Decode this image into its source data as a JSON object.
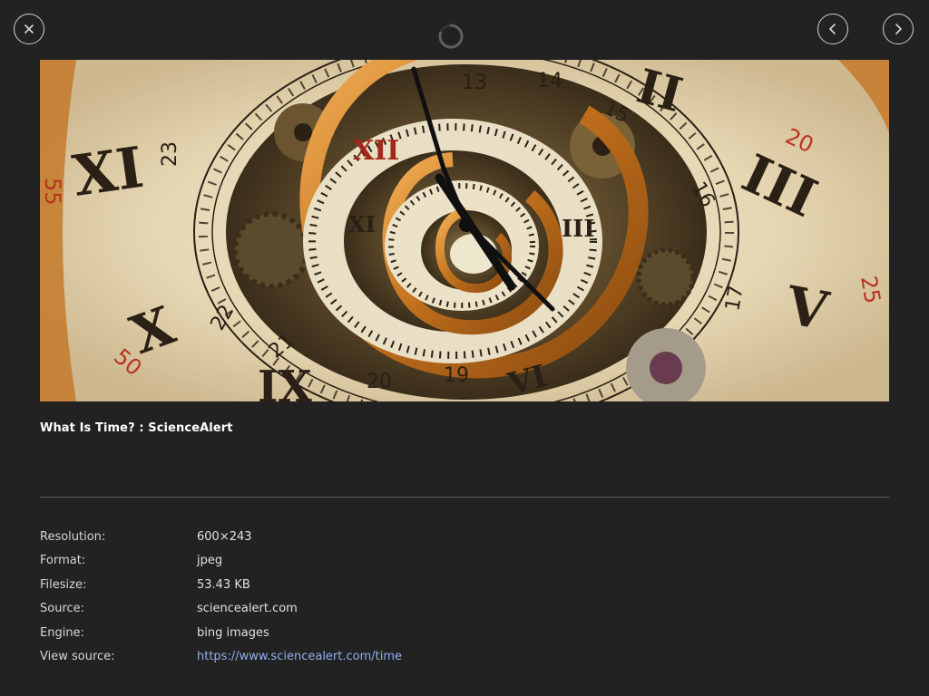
{
  "viewer": {
    "title": "What Is Time? : ScienceAlert",
    "image_alt": "What Is Time? : ScienceAlert"
  },
  "details": [
    {
      "label": "Resolution:",
      "value": "600×243"
    },
    {
      "label": "Format:",
      "value": "jpeg"
    },
    {
      "label": "Filesize:",
      "value": "53.43 KB"
    },
    {
      "label": "Source:",
      "value": "sciencealert.com"
    },
    {
      "label": "Engine:",
      "value": "bing images"
    },
    {
      "label": "View source:",
      "value": "https://www.sciencealert.com/time"
    }
  ],
  "icons": {
    "close": "close-icon",
    "prev": "chevron-left-icon",
    "next": "chevron-right-icon",
    "loading": "loading-spinner-icon"
  },
  "colors": {
    "background": "#222222",
    "link": "#8fb0f0",
    "divider": "#5a5a5a"
  }
}
